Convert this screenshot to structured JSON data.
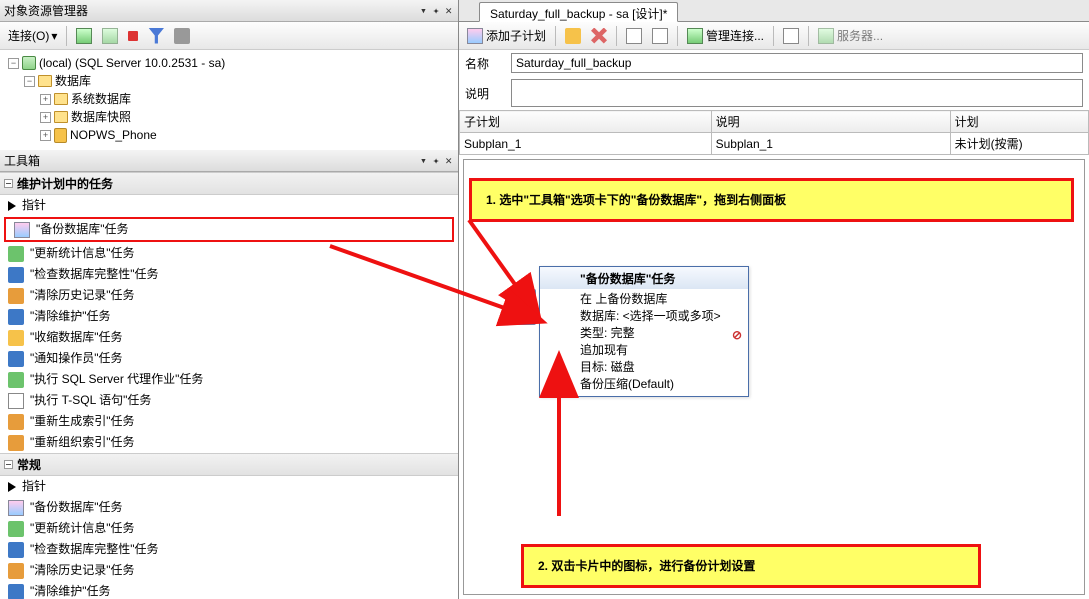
{
  "panels": {
    "objectExplorer": {
      "title": "对象资源管理器",
      "connectBtn": "连接(O)"
    },
    "toolbox": {
      "title": "工具箱"
    }
  },
  "tree": {
    "root": "(local) (SQL Server 10.0.2531 - sa)",
    "db": "数据库",
    "sysdb": "系统数据库",
    "snap": "数据库快照",
    "nopws": "NOPWS_Phone"
  },
  "toolbox_groups": {
    "maint": {
      "title": "维护计划中的任务"
    },
    "general": {
      "title": "常规"
    }
  },
  "toolbox_items": {
    "pointer": "指针",
    "backup": "\"备份数据库\"任务",
    "stats": "\"更新统计信息\"任务",
    "integrity": "\"检查数据库完整性\"任务",
    "history": "\"清除历史记录\"任务",
    "cleanup": "\"清除维护\"任务",
    "shrink": "\"收缩数据库\"任务",
    "notify": "\"通知操作员\"任务",
    "agent": "\"执行 SQL Server 代理作业\"任务",
    "tsql": "\"执行 T-SQL 语句\"任务",
    "rebuild": "\"重新生成索引\"任务",
    "reorg": "\"重新组织索引\"任务"
  },
  "tab": {
    "label": "Saturday_full_backup - sa [设计]*"
  },
  "design_toolbar": {
    "addSub": "添加子计划",
    "manageConn": "管理连接...",
    "server": "服务器..."
  },
  "form": {
    "nameLabel": "名称",
    "nameValue": "Saturday_full_backup",
    "descLabel": "说明",
    "descValue": ""
  },
  "subplan_grid": {
    "hSub": "子计划",
    "hDesc": "说明",
    "hSched": "计划",
    "row": {
      "sub": "Subplan_1",
      "desc": "Subplan_1",
      "sched": "未计划(按需)"
    }
  },
  "callouts": {
    "c1": "1.   选中\"工具箱\"选项卡下的\"备份数据库\"，拖到右侧面板",
    "c2": "2.   双击卡片中的图标，进行备份计划设置"
  },
  "card": {
    "title": "\"备份数据库\"任务",
    "l1": "在 上备份数据库",
    "l2": "数据库: <选择一项或多项>",
    "l3": "类型: 完整",
    "l4": "追加现有",
    "l5": "目标: 磁盘",
    "l6": "备份压缩(Default)"
  }
}
